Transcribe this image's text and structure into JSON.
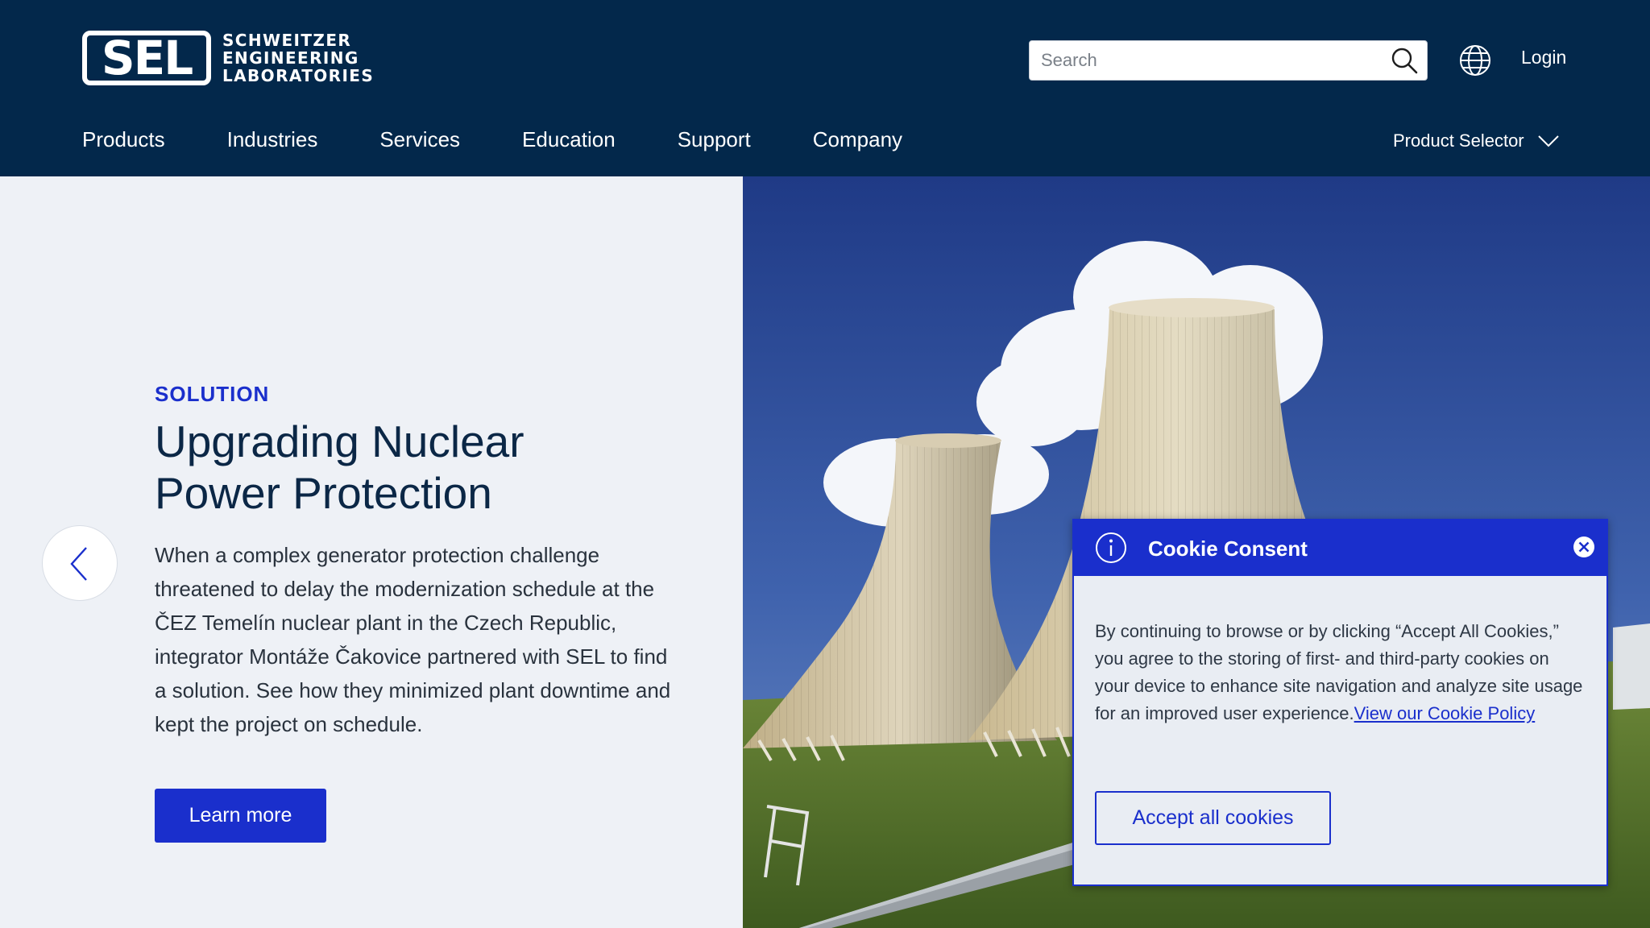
{
  "header": {
    "logo": {
      "mark": "SEL",
      "lines": [
        "SCHWEITZER",
        "ENGINEERING",
        "LABORATORIES"
      ]
    },
    "search": {
      "placeholder": "Search"
    },
    "login": "Login",
    "nav": [
      "Products",
      "Industries",
      "Services",
      "Education",
      "Support",
      "Company"
    ],
    "product_selector": "Product Selector"
  },
  "hero": {
    "eyebrow": "SOLUTION",
    "title_line1": "Upgrading Nuclear",
    "title_line2": "Power Protection",
    "description": "When a complex generator protection challenge threatened to delay the modernization schedule at the ČEZ Temelín nuclear plant in the Czech Republic, integrator Montáže Čakovice partnered with SEL to find a solution. See how they minimized plant downtime and kept the project on schedule.",
    "cta": "Learn more"
  },
  "cookie": {
    "title": "Cookie Consent",
    "body": "By continuing to browse or by clicking “Accept All Cookies,” you agree to the storing of first- and third-party cookies on your device to enhance site navigation and analyze site usage for an improved user experience.",
    "link": "View our Cookie Policy",
    "accept": "Accept all cookies"
  },
  "colors": {
    "header_bg": "#03284b",
    "accent": "#1a2fcc",
    "page_bg": "#eef1f6",
    "headline": "#0b2746"
  },
  "icons": [
    "search-icon",
    "globe-icon",
    "chevron-down-icon",
    "chevron-left-icon",
    "info-icon",
    "close-icon"
  ]
}
